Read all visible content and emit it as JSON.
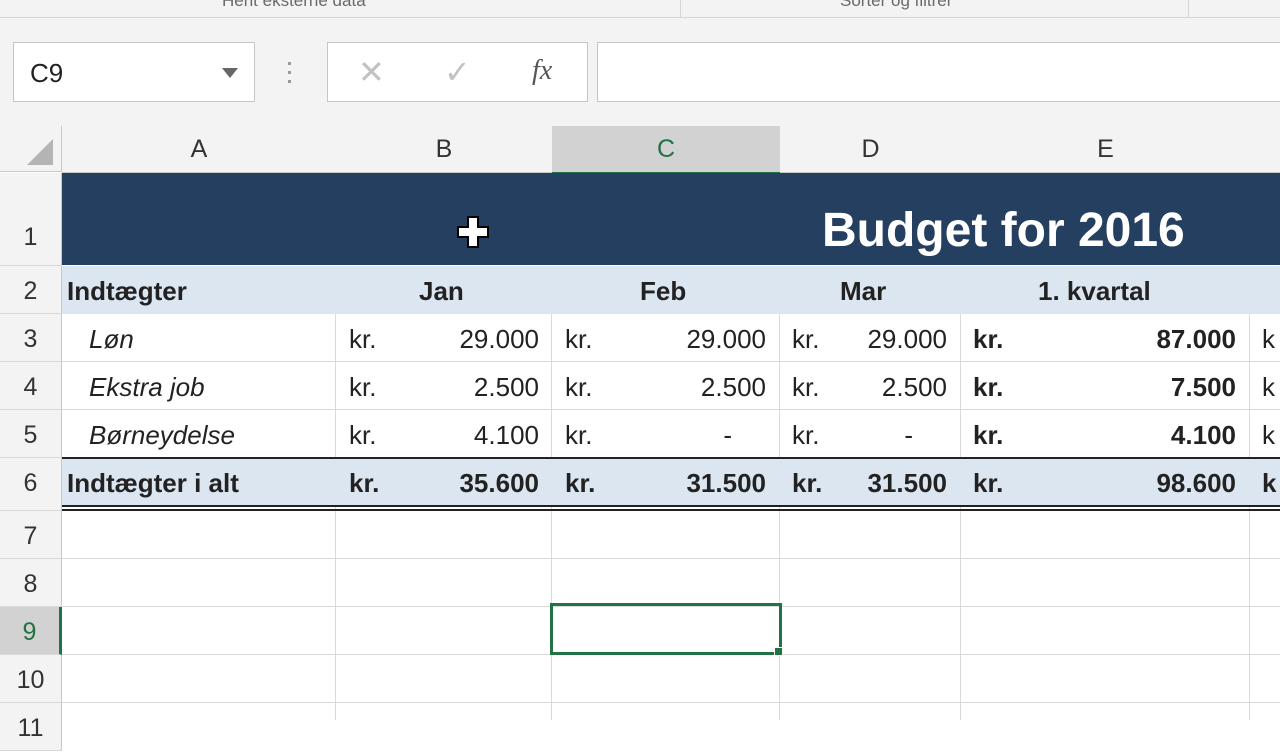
{
  "ribbon": {
    "groups": [
      "Hent eksterne data",
      "Sorter og filtrer"
    ]
  },
  "formula_bar": {
    "name_box": "C9",
    "cancel_icon": "✕",
    "enter_icon": "✓",
    "fx_label": "fx",
    "formula": ""
  },
  "columns": [
    "A",
    "B",
    "C",
    "D",
    "E"
  ],
  "selected_column": "C",
  "rows": [
    "1",
    "2",
    "3",
    "4",
    "5",
    "6",
    "7",
    "8",
    "9",
    "10",
    "11"
  ],
  "selected_row": "9",
  "sheet": {
    "title": "Budget for 2016",
    "headers": {
      "label": "Indtægter",
      "months": [
        "Jan",
        "Feb",
        "Mar"
      ],
      "quarter": "1. kvartal"
    },
    "currency": "kr.",
    "income_rows": [
      {
        "label": "Løn",
        "jan": "29.000",
        "feb": "29.000",
        "mar": "29.000",
        "q1": "87.000"
      },
      {
        "label": "Ekstra job",
        "jan": "2.500",
        "feb": "2.500",
        "mar": "2.500",
        "q1": "7.500"
      },
      {
        "label": "Børneydelse",
        "jan": "4.100",
        "feb": "-",
        "mar": "-",
        "q1": "4.100"
      }
    ],
    "total_row": {
      "label": "Indtægter i alt",
      "jan": "35.600",
      "feb": "31.500",
      "mar": "31.500",
      "q1": "98.600"
    },
    "next_col_partial": "k"
  },
  "colors": {
    "title_band": "#243f60",
    "header_band": "#dce6f1",
    "selection": "#217346"
  }
}
